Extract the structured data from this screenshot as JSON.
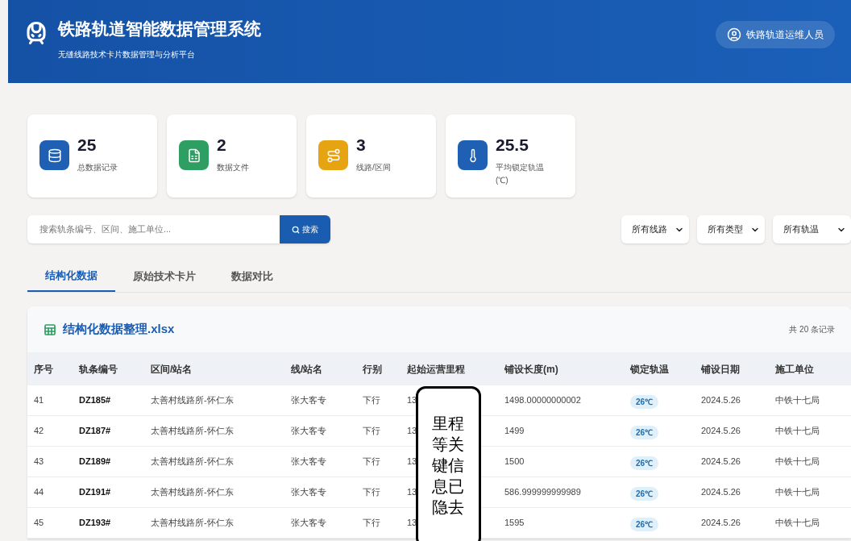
{
  "header": {
    "title": "铁路轨道智能数据管理系统",
    "subtitle": "无缝线路技术卡片数据管理与分析平台",
    "user": "铁路轨道运维人员"
  },
  "stats": [
    {
      "kind": "database",
      "value": "25",
      "label": "总数据记录"
    },
    {
      "kind": "file",
      "value": "2",
      "label": "数据文件"
    },
    {
      "kind": "route",
      "value": "3",
      "label": "线路/区间"
    },
    {
      "kind": "thermometer",
      "value": "25.5",
      "label": "平均锁定轨温(℃)"
    }
  ],
  "search": {
    "placeholder": "搜索轨条编号、区间、施工单位...",
    "button": "搜索"
  },
  "filters": [
    "所有线路",
    "所有类型",
    "所有轨温"
  ],
  "tabs": [
    {
      "label": "结构化数据",
      "selected": true
    },
    {
      "label": "原始技术卡片",
      "selected": false
    },
    {
      "label": "数据对比",
      "selected": false
    }
  ],
  "table": {
    "title": "结构化数据整理.xlsx",
    "count": "共 20 条记录",
    "columns": [
      "序号",
      "轨条编号",
      "区间/站名",
      "线/站名",
      "行别",
      "起始运营里程",
      "铺设长度(m)",
      "锁定轨温",
      "铺设日期",
      "施工单位"
    ],
    "rows": [
      [
        "41",
        "DZ185#",
        "太善村线路所-怀仁东",
        "张大客专",
        "下行",
        "13",
        "1498.00000000002",
        "26℃",
        "2024.5.26",
        "中铁十七局"
      ],
      [
        "42",
        "DZ187#",
        "太善村线路所-怀仁东",
        "张大客专",
        "下行",
        "13",
        "1499",
        "26℃",
        "2024.5.26",
        "中铁十七局"
      ],
      [
        "43",
        "DZ189#",
        "太善村线路所-怀仁东",
        "张大客专",
        "下行",
        "13",
        "1500",
        "26℃",
        "2024.5.26",
        "中铁十七局"
      ],
      [
        "44",
        "DZ191#",
        "太善村线路所-怀仁东",
        "张大客专",
        "下行",
        "13",
        "586.999999999989",
        "26℃",
        "2024.5.26",
        "中铁十七局"
      ],
      [
        "45",
        "DZ193#",
        "太善村线路所-怀仁东",
        "张大客专",
        "下行",
        "13",
        "1595",
        "26℃",
        "2024.5.26",
        "中铁十七局"
      ]
    ]
  },
  "redaction_note": "里程等关键信息已隐去"
}
